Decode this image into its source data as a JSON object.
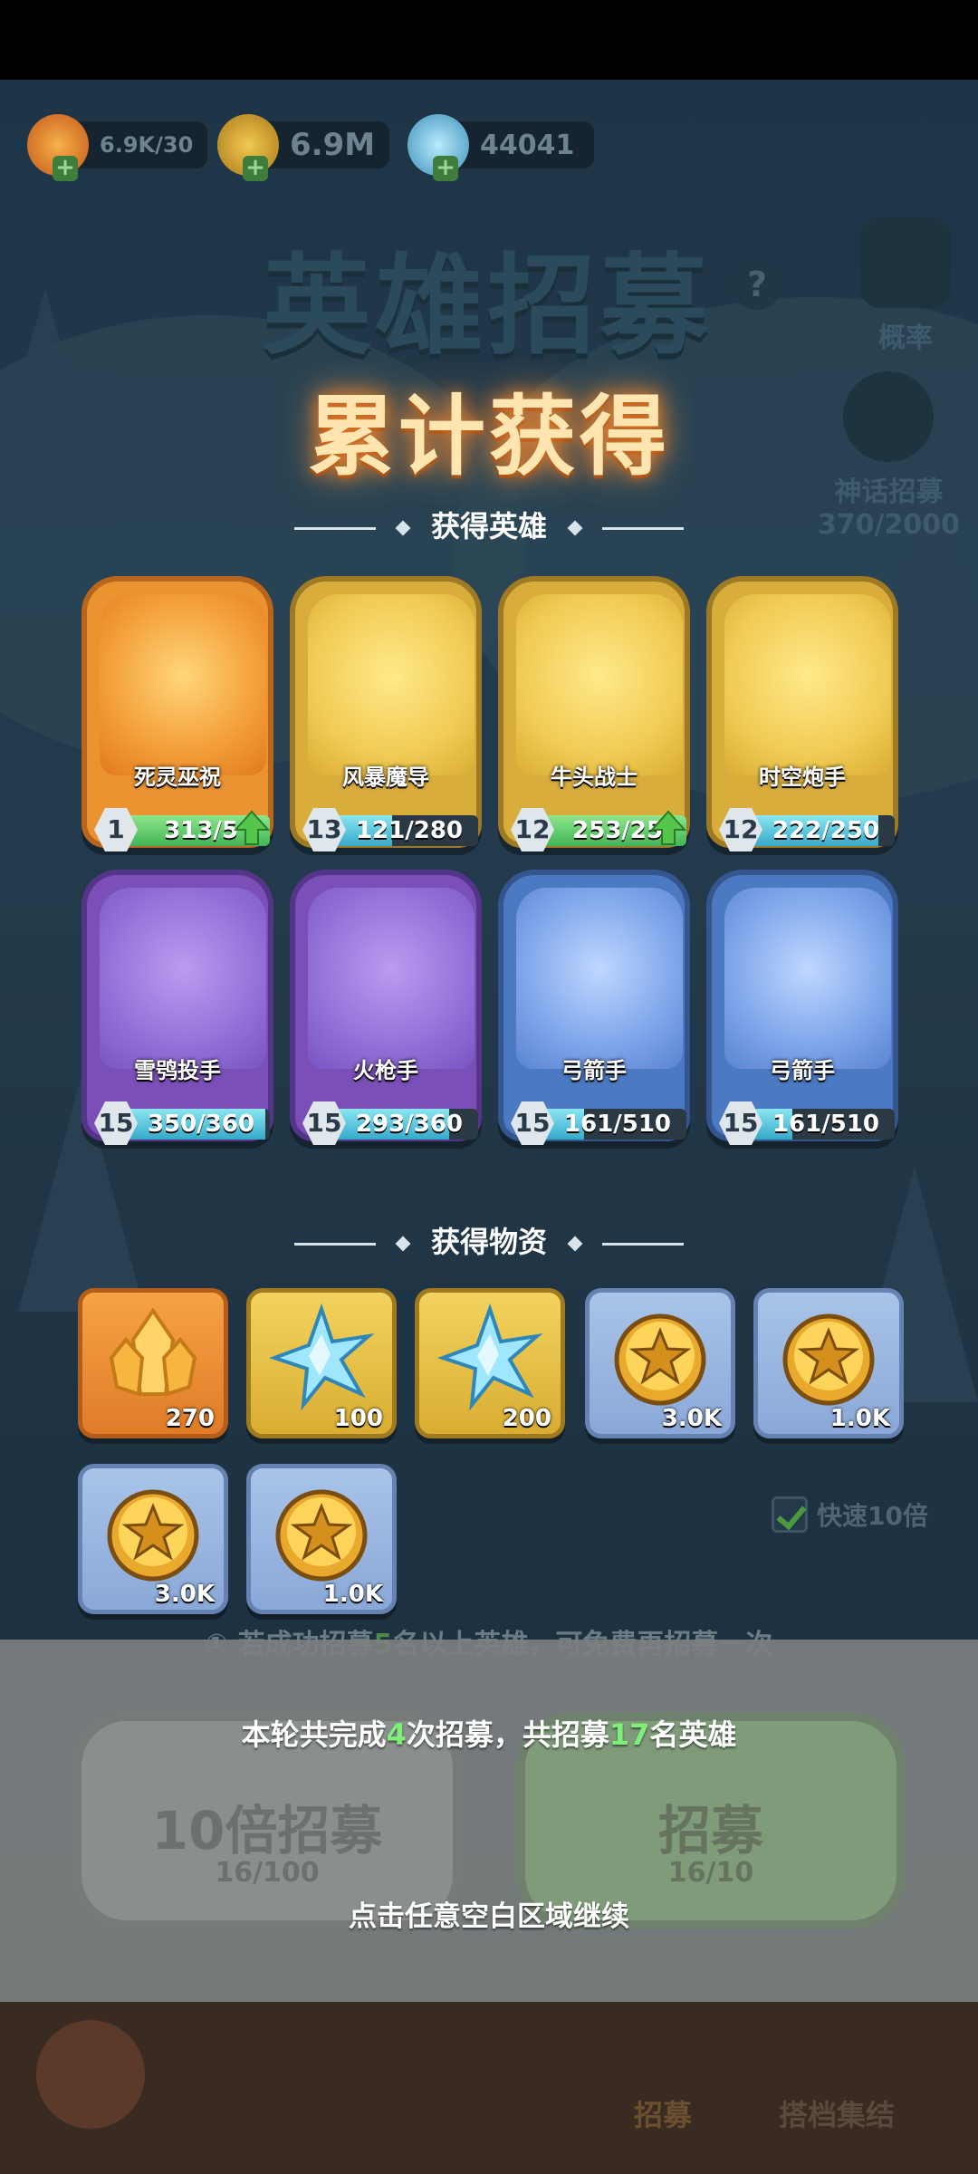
{
  "top_resources": [
    {
      "name": "energy",
      "value": "6.9K/30",
      "icon": "flame-icon",
      "color": "#e5762a"
    },
    {
      "name": "gold",
      "value": "6.9M",
      "icon": "coin-icon",
      "color": "#d7a52c"
    },
    {
      "name": "crystal",
      "value": "44041",
      "icon": "snowflake-crystal-icon",
      "color": "#6fc0e0"
    }
  ],
  "background": {
    "title": "英雄招募",
    "rate_label": "概率",
    "mythic_label": "神话招募",
    "mythic_progress": "370/2000"
  },
  "overlay": {
    "title": "累计获得",
    "heroes_header": "获得英雄",
    "items_header": "获得物资"
  },
  "heroes": [
    {
      "name": "死灵巫祝",
      "level": "1",
      "progress": "313/5",
      "fill": 1.0,
      "rarity": "orange",
      "upgrade": true
    },
    {
      "name": "风暴魔导",
      "level": "13",
      "progress": "121/280",
      "fill": 0.43,
      "rarity": "gold",
      "upgrade": false
    },
    {
      "name": "牛头战士",
      "level": "12",
      "progress": "253/25",
      "fill": 1.0,
      "rarity": "gold",
      "upgrade": true
    },
    {
      "name": "时空炮手",
      "level": "12",
      "progress": "222/250",
      "fill": 0.89,
      "rarity": "gold",
      "upgrade": false
    },
    {
      "name": "雪鸮投手",
      "level": "15",
      "progress": "350/360",
      "fill": 0.97,
      "rarity": "purple",
      "upgrade": false
    },
    {
      "name": "火枪手",
      "level": "15",
      "progress": "293/360",
      "fill": 0.81,
      "rarity": "purple",
      "upgrade": false
    },
    {
      "name": "弓箭手",
      "level": "15",
      "progress": "161/510",
      "fill": 0.32,
      "rarity": "blue",
      "upgrade": false
    },
    {
      "name": "弓箭手",
      "level": "15",
      "progress": "161/510",
      "fill": 0.32,
      "rarity": "blue",
      "upgrade": false
    }
  ],
  "items": [
    {
      "icon": "crystal-shard-icon",
      "count": "270",
      "rarity": "orange"
    },
    {
      "icon": "ice-crystal-icon",
      "count": "100",
      "rarity": "gold"
    },
    {
      "icon": "ice-crystal-icon",
      "count": "200",
      "rarity": "gold"
    },
    {
      "icon": "gold-coin-icon",
      "count": "3.0K",
      "rarity": "blue"
    },
    {
      "icon": "gold-coin-icon",
      "count": "1.0K",
      "rarity": "blue"
    },
    {
      "icon": "gold-coin-icon",
      "count": "3.0K",
      "rarity": "blue"
    },
    {
      "icon": "gold-coin-icon",
      "count": "1.0K",
      "rarity": "blue"
    }
  ],
  "quick_toggle": "快速10倍",
  "tip": {
    "prefix": "若成功招募",
    "number": "5",
    "suffix": "名以上英雄，可免费再招募一次"
  },
  "summary": {
    "p1": "本轮共完成",
    "n1": "4",
    "p2": "次招募，共招募",
    "n2": "17",
    "p3": "名英雄"
  },
  "background_buttons": {
    "ten_label": "10倍招募",
    "ten_keys": "16/100",
    "single_label": "招募",
    "single_keys": "16/10"
  },
  "bottom_nav": {
    "recruit": "招募",
    "team": "搭档集结"
  },
  "continue_text": "点击任意空白区域继续"
}
